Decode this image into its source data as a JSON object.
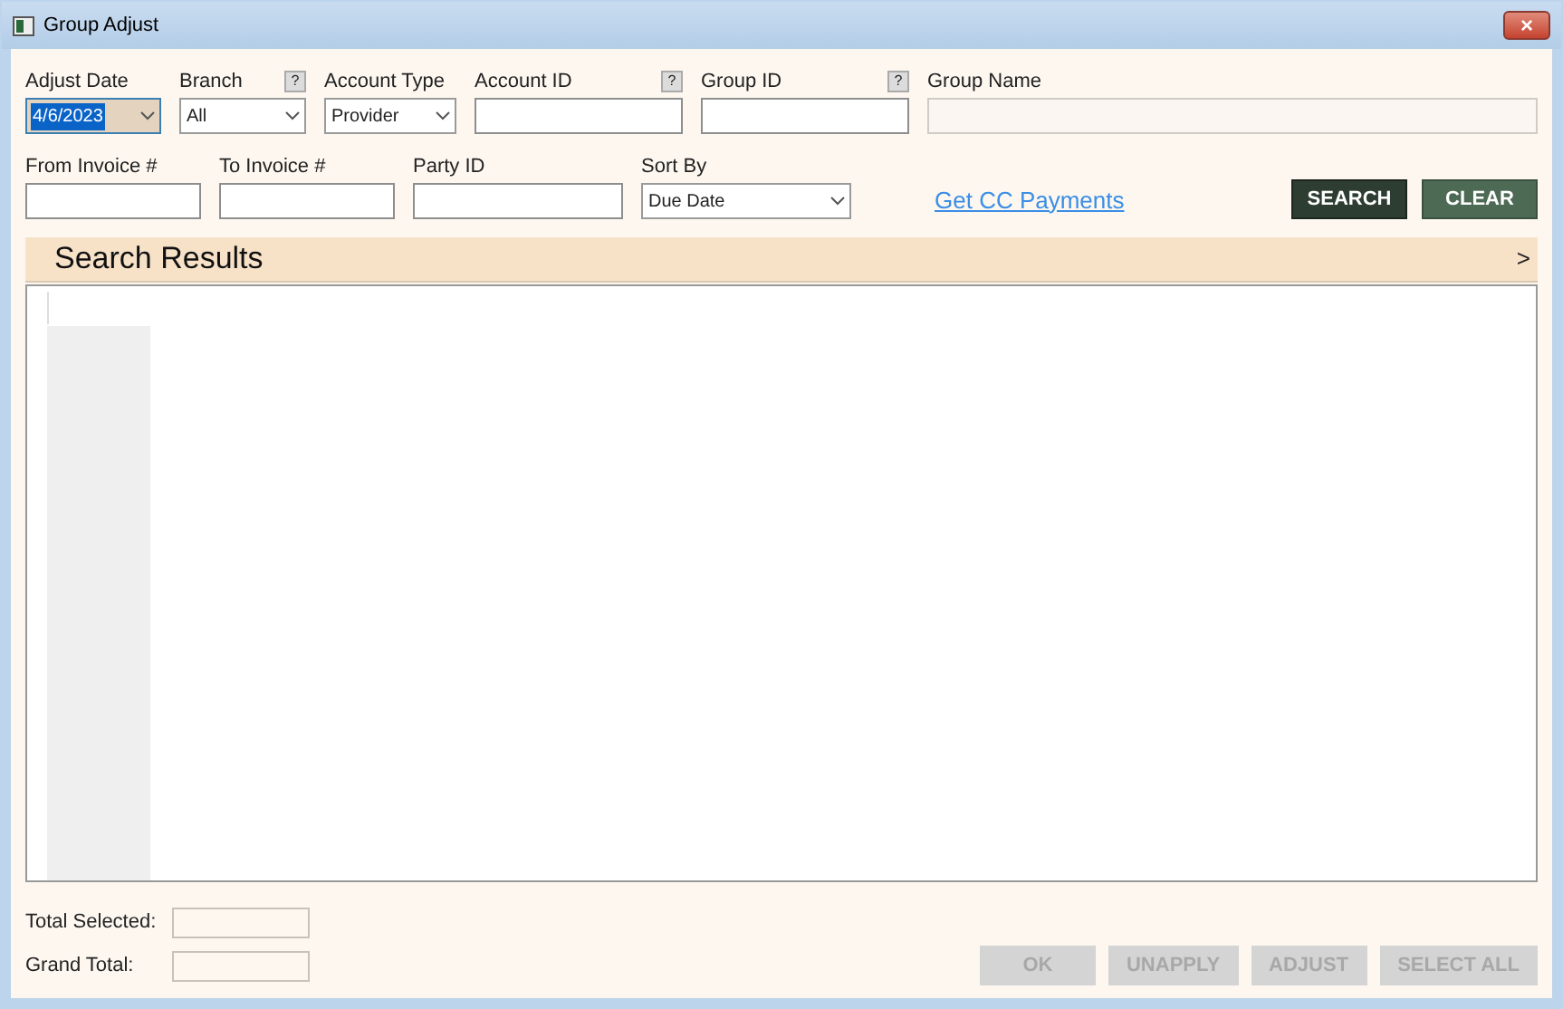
{
  "window": {
    "title": "Group Adjust",
    "close": "×"
  },
  "row1": [
    {
      "kind": "combo",
      "label": "Adjust Date",
      "value": "4/6/2023",
      "selected": true
    },
    {
      "kind": "combo",
      "label": "Branch",
      "value": "All",
      "selected": false,
      "help_text": "?"
    },
    {
      "kind": "combo",
      "label": "Account Type",
      "value": "Provider",
      "selected": false
    },
    {
      "kind": "text",
      "label": "Account ID",
      "help_text": "?"
    },
    {
      "kind": "text",
      "label": "Group ID",
      "help_text": "?"
    },
    {
      "kind": "readonly",
      "label": "Group Name"
    }
  ],
  "row2": [
    {
      "kind": "text",
      "label": "From Invoice #"
    },
    {
      "kind": "text",
      "label": "To Invoice #"
    },
    {
      "kind": "text",
      "label": "Party ID"
    },
    {
      "kind": "combo",
      "label": "Sort By",
      "value": "Due Date"
    }
  ],
  "link": "Get CC Payments",
  "actions": [
    {
      "label": "SEARCH",
      "disabled": false
    },
    {
      "label": "CLEAR",
      "disabled": false
    }
  ],
  "results": {
    "title": "Search Results",
    "expand": ">"
  },
  "totals": [
    {
      "label": "Total Selected:"
    },
    {
      "label": "Grand Total:"
    }
  ],
  "buttons": [
    {
      "label": "OK",
      "disabled": true
    },
    {
      "label": "UNAPPLY",
      "disabled": true
    },
    {
      "label": "ADJUST",
      "disabled": true
    },
    {
      "label": "SELECT ALL",
      "disabled": true
    }
  ]
}
